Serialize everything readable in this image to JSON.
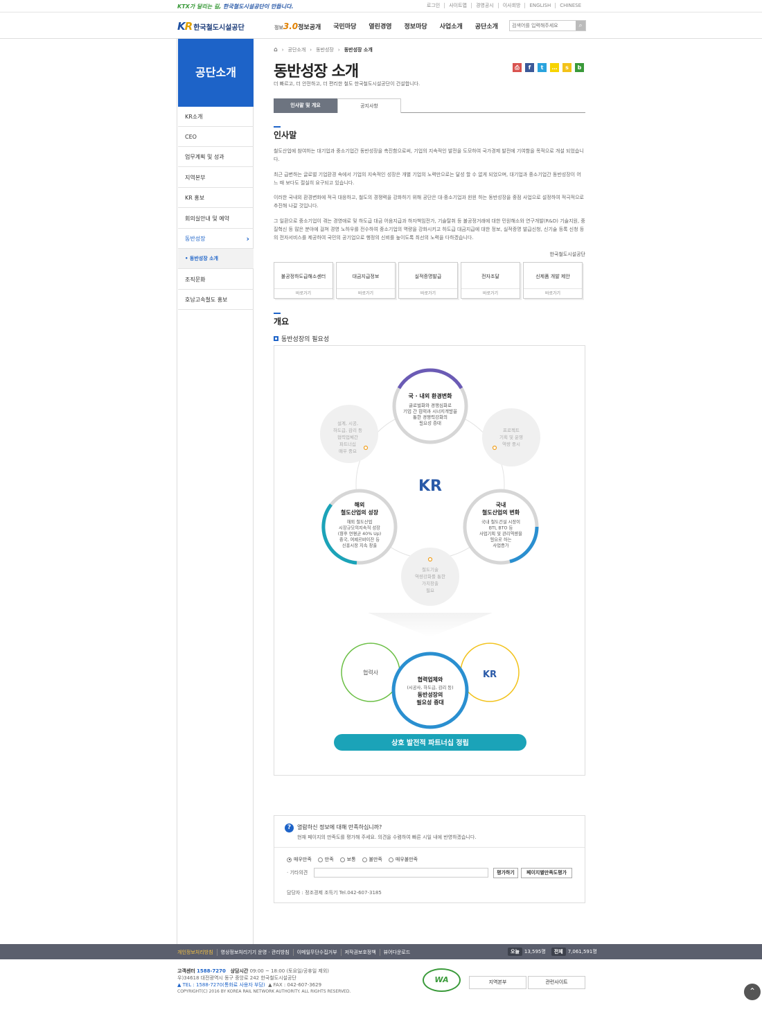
{
  "topbar": {
    "slogan_part1": "KTX가 달리는 길, ",
    "slogan_part2": "한국철도시설공단이 만듭니다.",
    "links": [
      "로그인",
      "사이트맵",
      "경영공시",
      "이사회방",
      "ENGLISH",
      "CHINESE"
    ]
  },
  "header": {
    "logo_mark_k": "K",
    "logo_mark_r": "R",
    "logo_text": "한국철도시설공단",
    "gnb": {
      "prefix": "정보",
      "three": "3.0",
      "items": [
        "정보공개",
        "국민마당",
        "열린경영",
        "정보마당",
        "사업소개",
        "공단소개"
      ]
    },
    "search_placeholder": "검색어를 입력해주세요",
    "search_icon": "⌕"
  },
  "lnb": {
    "title": "공단소개",
    "items": [
      "KR소개",
      "CEO",
      "업무계획 및 성과",
      "지역본부",
      "KR 홍보",
      "회의실안내 및 예약",
      "동반성장",
      "조직문화",
      "호남고속철도 홍보"
    ],
    "active_arrow": "›",
    "sub_item": "• 동반성장 소개"
  },
  "breadcrumb": {
    "home_icon": "⌂",
    "items": [
      "공단소개",
      "동반성장",
      "동반성장 소개"
    ],
    "sep": "›"
  },
  "page": {
    "title": "동반성장 소개",
    "desc": "더 빠르고, 더 안전하고, 더 편리한 철도 한국철도시설공단이 건설합니다.",
    "share_icons": [
      {
        "name": "print-icon",
        "glyph": "⎙",
        "color": "#d9534f"
      },
      {
        "name": "facebook-icon",
        "glyph": "f",
        "color": "#3b5998"
      },
      {
        "name": "twitter-icon",
        "glyph": "t",
        "color": "#2aa3dd"
      },
      {
        "name": "kakaotalk-icon",
        "glyph": "…",
        "color": "#f7d400"
      },
      {
        "name": "kakaostory-icon",
        "glyph": "s",
        "color": "#f3c21a"
      },
      {
        "name": "band-icon",
        "glyph": "b",
        "color": "#3a9a3a"
      }
    ]
  },
  "tabs": [
    "인사말 및 개요",
    "공지사항"
  ],
  "greeting": {
    "title": "인사말",
    "paragraphs": [
      "철도산업에 참여하는 대기업과 중소기업간 동반성장을 촉진함으로써, 기업의 지속적인 발전을 도모하여 국가경제 발전에 기여함을 목적으로 개설 되었습니다.",
      "최근 급변하는 글로벌 기업환경 속에서 기업의 지속적인 성장은 개별 기업의 노력만으로는 달성 할 수 없게 되었으며, 대기업과 중소기업간 동반성장이 어느 때 보다도 절실히 요구되고 있습니다.",
      "이러한 국내외 환경변화에 적극 대응하고, 철도의 경쟁력을 강화하기 위해 공단은 대·중소기업과 윈윈 하는 동반성장을 중점 사업으로 설정하여 적극적으로 추진해 나갈 것입니다.",
      "그 일환으로 중소기업이 겪는 경영애로 및 하도급 대금 어음지급과 하자책임전가, 기술탈취 등 불공정거래에 대한 민원해소와 연구개발(R&D) 기술지원, 중질혁신 등 많은 분야에 걸쳐 경영 노하우를 전수하여 중소기업의 역량을 강화시키고 하도급 대금지급에 대한 정보, 실적증명 발급신청, 신기술 등록 신청 등의 전자서비스를 제공하여 국민의 공기업으로 행정의 신뢰를 높이도록 최선의 노력을 다하겠습니다."
    ],
    "signature": "한국철도시설공단"
  },
  "quick_links": {
    "items": [
      "불공정하도급해소센터",
      "대금지급정보",
      "실적증명발급",
      "전자조달",
      "신제품 개발 제안"
    ],
    "go_label": "바로가기"
  },
  "overview": {
    "title": "개요",
    "subtitle": "동반성장의 필요성"
  },
  "diagram": {
    "center_logo": "KR",
    "top": {
      "title": "국 · 내외 환경변화",
      "lines": [
        "글로벌화와 경쟁심화로",
        "기업 간 협력과 시너지개발을",
        "통한 경쟁력강화의",
        "필요성 증대"
      ]
    },
    "left": {
      "title": "해외",
      "title2": "철도산업의 성장",
      "lines": [
        "해외 철도산업",
        "시장규모의지속적 성장",
        "(향후 연평균 40% Up)",
        "중국, 여제르바이잔 등",
        "신흥시장 지속 창출"
      ]
    },
    "right": {
      "title": "국내",
      "title2": "철도산업의 변화",
      "lines": [
        "국내 철도건설 시장이",
        "BTL BTO 등",
        "사업기획 및 관리역량을",
        "필요로 하는",
        "사업증가"
      ]
    },
    "gray_tl": [
      "설계, 시공,",
      "하도급, 감리 등",
      "협력업체간",
      "파트너십",
      "매우 중요"
    ],
    "gray_tr": [
      "프로젝트",
      "기획 및 운영",
      "역량 중시"
    ],
    "gray_b": [
      "철도기술",
      "역량강화를 통한",
      "가치창출",
      "필요"
    ],
    "bottom_left": "협력사",
    "bottom_right_logo": "KR",
    "bottom_center": [
      "협력업체와",
      "(시공사, 하도급, 감리 등)",
      "동반성장의",
      "필요성 증대"
    ],
    "banner": "상호 발전적 파트너십 정립",
    "colors": {
      "purple": "#6b5bb5",
      "teal": "#1ba3b8",
      "blue": "#2a8fd0",
      "green": "#6bbf45",
      "yellow": "#f2c21a",
      "kr_blue": "#2a5aa8"
    }
  },
  "survey": {
    "question": "열람하신 정보에 대해 만족하십니까?",
    "question_icon": "?",
    "desc": "현재 페이지의 만족도를 평가해 주세요. 의견을 수렴하여 빠른 시일 내에 반영하겠습니다.",
    "options": [
      "매우만족",
      "만족",
      "보통",
      "불만족",
      "매우불만족"
    ],
    "etc_label": "· 기타의견",
    "submit_label": "평가하기",
    "page_eval_label": "페이지별만족도평가",
    "manager": "담당자 : 정조경제 조득기 Tel.042-607-3185"
  },
  "footer": {
    "links": [
      "개인정보처리방침",
      "영상정보처리기기 운영 · 관리방침",
      "이메일무단수집거부",
      "저작권보호정책",
      "뷰어다운로드"
    ],
    "today_label": "오늘",
    "today_value": "13,595명",
    "total_label": "전체",
    "total_value": "7,061,591명",
    "cs_label": "고객센터",
    "cs_phone": "1588-7270",
    "hours_label": "상담시간",
    "hours": "09:00 ~ 18:00 (토요일/공휴일 제외)",
    "address": "우)34618 대전광역시 동구 중앙로 242 한국철도시설공단",
    "tel": "▲ TEL : 1588-7270(통화료 사용자 부담)",
    "fax": "▲ FAX : 042-607-3629",
    "copyright": "COPYRIGHT(C) 2016 BY KOREA RAIL NETWORK AUTHORITY. ALL RIGHTS RESERVED.",
    "wa_mark": "WA",
    "region_btn": "지역본부",
    "related_btn": "관련사이트",
    "top_btn": "⌃"
  }
}
